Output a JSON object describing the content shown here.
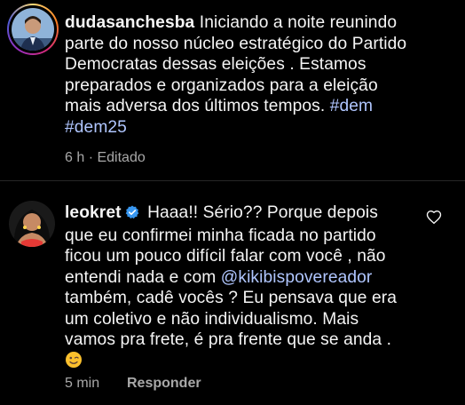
{
  "caption": {
    "username": "dudasanchesba",
    "lines": [
      "Iniciando a noite reunindo",
      "parte do nosso núcleo estratégico do Partido",
      "Democratas dessas eleições . Estamos",
      "preparados e organizados para a eleição",
      "mais adversa dos últimos tempos."
    ],
    "hashtag1": "#dem",
    "hashtag2": "#dem25",
    "time": "6 h",
    "separator": "·",
    "edited": "Editado"
  },
  "reply": {
    "username": "leokret",
    "lines": [
      "Haaa!! Sério?? Porque depois",
      "que eu confirmei minha ficada no partido",
      "ficou um pouco difícil falar com você , não",
      "entendi nada e com"
    ],
    "mention": "@kikibispovereador",
    "lines_after": [
      "também, cadê vocês ? Eu pensava que era",
      "um coletivo e não individualismo. Mais",
      "vamos pra frete, é pra frente que se anda ."
    ],
    "emoji": "wink-emoji",
    "time": "5 min",
    "reply_label": "Responder"
  },
  "colors": {
    "background": "#000000",
    "text": "#f5f5f5",
    "link": "#b0c6ff",
    "meta": "#a8a8a8",
    "verified": "#3897f0"
  }
}
